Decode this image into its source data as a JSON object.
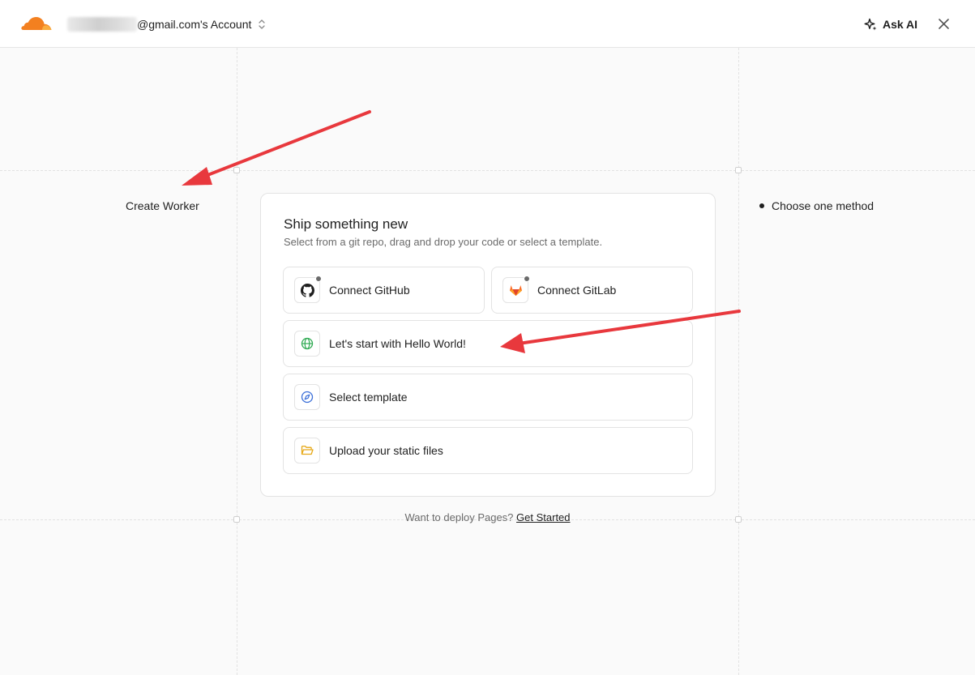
{
  "header": {
    "account_suffix": "@gmail.com's Account",
    "ask_ai_label": "Ask AI"
  },
  "side": {
    "left_label": "Create Worker",
    "right_label": "Choose one method"
  },
  "card": {
    "title": "Ship something new",
    "subtitle": "Select from a git repo, drag and drop your code or select a template.",
    "options": [
      {
        "label": "Connect GitHub",
        "icon": "github-icon"
      },
      {
        "label": "Connect GitLab",
        "icon": "gitlab-icon"
      },
      {
        "label": "Let's start with Hello World!",
        "icon": "globe-icon"
      },
      {
        "label": "Select template",
        "icon": "compass-icon"
      },
      {
        "label": "Upload your static files",
        "icon": "folder-icon"
      }
    ]
  },
  "footer": {
    "question": "Want to deploy Pages?",
    "link": "Get Started"
  },
  "colors": {
    "brand_orange": "#f38020",
    "annotation_red": "#e8383d",
    "globe_green": "#2faa52",
    "compass_blue": "#3b6fd8",
    "folder_yellow": "#e6a817"
  }
}
